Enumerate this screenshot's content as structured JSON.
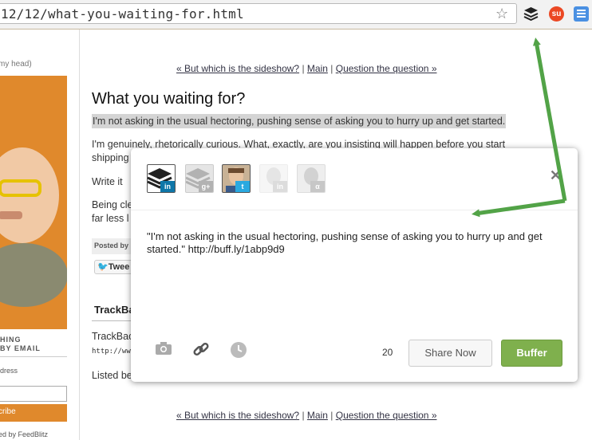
{
  "browser": {
    "url": "12/12/what-you-waiting-for.html",
    "extensions": [
      "buffer-icon",
      "stumbleupon-icon",
      "notes-icon"
    ]
  },
  "sidebar": {
    "top_text": "my head)",
    "subscribe_heading": "HING\nBY EMAIL",
    "address_label": "dress",
    "subscribe_label": "cribe",
    "powered_by": "ed by FeedBlitz"
  },
  "nav": {
    "prev": "« But which is the sideshow?",
    "sep": "|",
    "main": "Main",
    "next": "Question the question »"
  },
  "post": {
    "title": "What you waiting for?",
    "highlight": "I'm not asking in the usual hectoring, pushing sense of asking you to hurry up and get started.",
    "p2_line1": "I'm genuinely, rhetorically curious. What, exactly, are you insisting will happen before you start",
    "p2_line2": "shipping",
    "p3": "Write it",
    "p4_line1": "Being cle",
    "p4_line2": "far less l",
    "posted_by": "Posted by",
    "tweet": "Twee",
    "trackbacks_heading": "TrackBa",
    "trackback_text": "TrackBac",
    "trackback_url": "http://www",
    "listed": "Listed be"
  },
  "popup": {
    "message": "\"I'm not asking in the usual hectoring, pushing sense of asking you to hurry up and get started.\" http://buff.ly/1abp9d9",
    "char_count": "20",
    "share_now": "Share Now",
    "buffer": "Buffer",
    "profiles": [
      {
        "service": "in",
        "selected": true
      },
      {
        "service": "g+",
        "selected": false
      },
      {
        "service": "twitter",
        "selected": true
      },
      {
        "service": "in",
        "selected": false
      },
      {
        "service": "α",
        "selected": false
      }
    ]
  },
  "colors": {
    "accent": "#7fb04d",
    "arrow": "#52a347",
    "sidebar_photo": "#e0892c"
  }
}
